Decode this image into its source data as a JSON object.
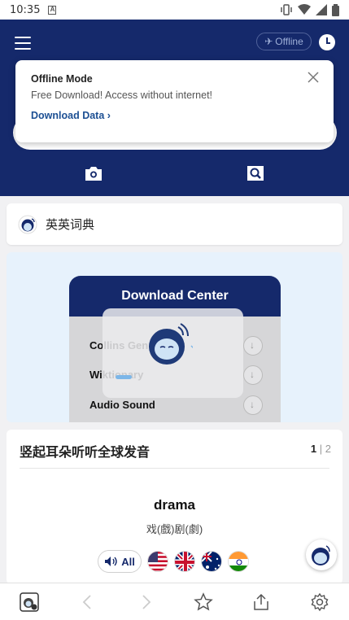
{
  "status_bar": {
    "time": "10:35",
    "a_icon": "A"
  },
  "header": {
    "offline_label": "Offline",
    "icons": [
      "menu-icon",
      "airplane-icon",
      "clock-icon",
      "camera-icon",
      "scan-search-icon"
    ]
  },
  "popup": {
    "title": "Offline Mode",
    "description": "Free Download! Access without internet!",
    "link": "Download Data",
    "link_arrow": "›"
  },
  "dictionary": {
    "label": "英英词典"
  },
  "download_banner": {
    "title": "Download Center",
    "items": [
      "Collins Gen",
      "Wiktionary",
      "Audio Sound"
    ]
  },
  "pronunciation": {
    "title": "竖起耳朵听听全球发音",
    "page_current": "1",
    "page_separator": "|",
    "page_total": "2",
    "word": "drama",
    "translation": "戏(戲)剧(劇)",
    "all_label": "All",
    "flags": [
      "us-flag",
      "uk-flag",
      "au-flag",
      "in-flag"
    ]
  },
  "bottom_bar": {
    "icons": [
      "app-logo-icon",
      "back-icon",
      "forward-icon",
      "star-icon",
      "share-icon",
      "settings-icon"
    ]
  },
  "colors": {
    "header": "#15296b",
    "accent": "#1c4f93",
    "banner_bg": "#e7f2fc"
  }
}
